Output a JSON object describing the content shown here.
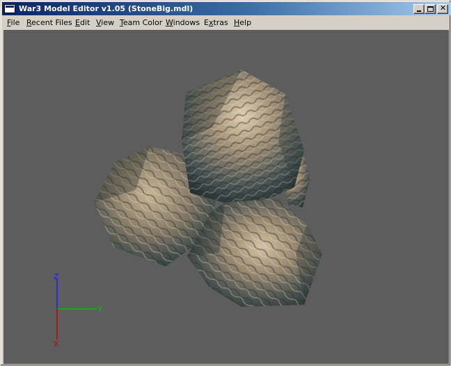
{
  "window": {
    "title": "War3 Model Editor v1.05 (StoneBig.mdl)"
  },
  "caption_buttons": {
    "minimize": "minimize",
    "maximize": "maximize",
    "close": "close"
  },
  "menu": {
    "items": [
      {
        "label": "File",
        "mnemonic": "F"
      },
      {
        "label": "Recent Files",
        "mnemonic": "R"
      },
      {
        "label": "Edit",
        "mnemonic": "E"
      },
      {
        "label": "View",
        "mnemonic": "V"
      },
      {
        "label": "Team Color",
        "mnemonic": "T"
      },
      {
        "label": "Windows",
        "mnemonic": "W"
      },
      {
        "label": "Extras",
        "mnemonic": "x"
      },
      {
        "label": "Help",
        "mnemonic": "H"
      }
    ]
  },
  "viewport": {
    "background": "#5d5d5d",
    "axes": {
      "z_label": "Z",
      "y_label": "Y",
      "x_label": "X",
      "z_color": "#0000ff",
      "y_color": "#00cc00",
      "x_color": "#cc0000"
    },
    "model": {
      "name": "StoneBig.mdl",
      "stones": 3
    }
  },
  "icons": {
    "app": "window-app-icon",
    "minimize": "minimize-icon",
    "maximize": "maximize-icon",
    "close": "close-icon"
  }
}
